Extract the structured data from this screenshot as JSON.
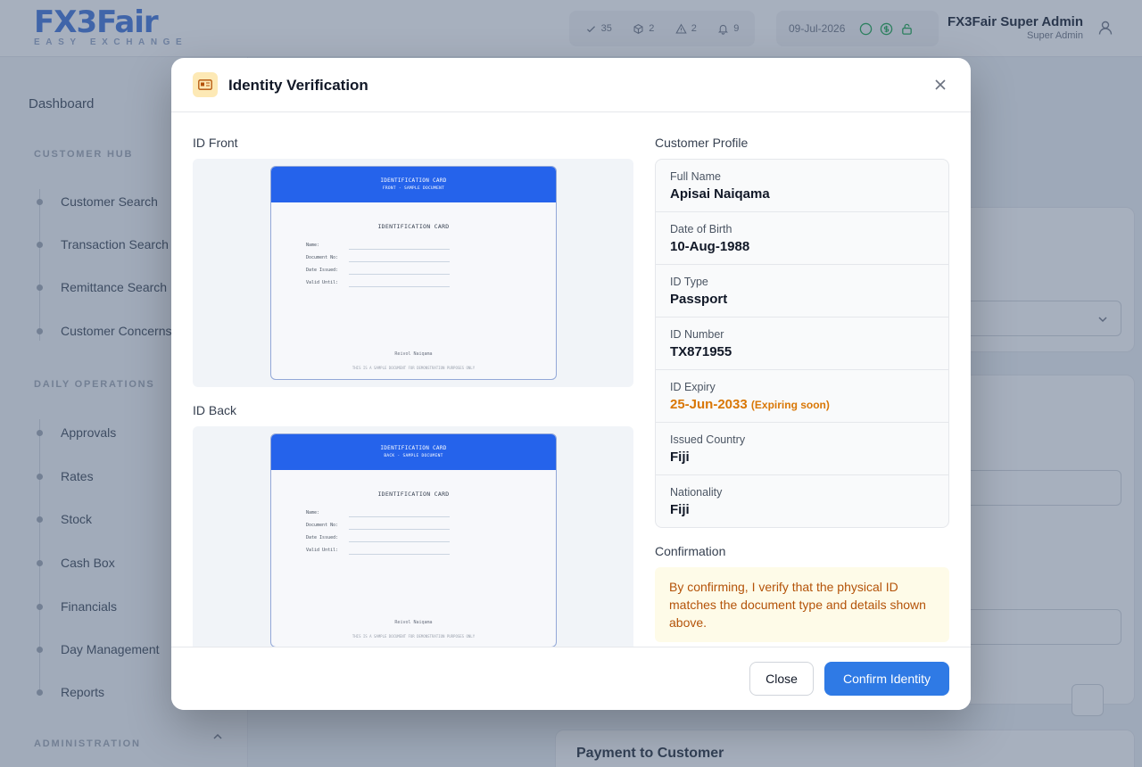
{
  "app": {
    "logo_main": "FX3Fair",
    "logo_sub": "EASY EXCHANGE"
  },
  "topbar": {
    "stats": [
      {
        "icon": "check-icon",
        "value": "35"
      },
      {
        "icon": "box-icon",
        "value": "2"
      },
      {
        "icon": "alert-triangle-icon",
        "value": "2"
      },
      {
        "icon": "bell-icon",
        "value": "9"
      }
    ],
    "date": "09-Jul-2026",
    "user_name": "FX3Fair Super Admin",
    "user_role": "Super Admin"
  },
  "sidebar": {
    "dashboard": "Dashboard",
    "customer_hub": {
      "heading": "CUSTOMER HUB",
      "items": [
        "Customer Search",
        "Transaction Search",
        "Remittance Search",
        "Customer Concerns"
      ]
    },
    "daily_operations": {
      "heading": "DAILY OPERATIONS",
      "items": [
        "Approvals",
        "Rates",
        "Stock",
        "Cash Box",
        "Financials",
        "Day Management",
        "Reports"
      ]
    },
    "administration": {
      "heading": "ADMINISTRATION"
    }
  },
  "background": {
    "payment_title": "Payment to Customer"
  },
  "modal": {
    "title": "Identity Verification",
    "id_front": {
      "label": "ID Front",
      "band_title": "IDENTIFICATION CARD",
      "band_subtitle": "FRONT - SAMPLE DOCUMENT",
      "heading": "IDENTIFICATION CARD",
      "fields": [
        "Name:",
        "Document No:",
        "Date Issued:",
        "Valid Until:"
      ],
      "signature": "Reivol Naiqama",
      "footer": "THIS IS A SAMPLE DOCUMENT FOR DEMONSTRATION PURPOSES ONLY"
    },
    "id_back": {
      "label": "ID Back",
      "band_title": "IDENTIFICATION CARD",
      "band_subtitle": "BACK - SAMPLE DOCUMENT",
      "heading": "IDENTIFICATION CARD",
      "fields": [
        "Name:",
        "Document No:",
        "Date Issued:",
        "Valid Until:"
      ],
      "signature": "Reivol Naiqama",
      "footer": "THIS IS A SAMPLE DOCUMENT FOR DEMONSTRATION PURPOSES ONLY"
    },
    "profile": {
      "label": "Customer Profile",
      "rows": [
        {
          "label": "Full Name",
          "value": "Apisai Naiqama"
        },
        {
          "label": "Date of Birth",
          "value": "10-Aug-1988"
        },
        {
          "label": "ID Type",
          "value": "Passport"
        },
        {
          "label": "ID Number",
          "value": "TX871955"
        },
        {
          "label": "ID Expiry",
          "value": "25-Jun-2033",
          "note": "(Expiring soon)"
        },
        {
          "label": "Issued Country",
          "value": "Fiji"
        },
        {
          "label": "Nationality",
          "value": "Fiji"
        }
      ]
    },
    "confirmation": {
      "label": "Confirmation",
      "text": "By confirming, I verify that the physical ID matches the document type and details shown above."
    },
    "buttons": {
      "close": "Close",
      "confirm": "Confirm Identity"
    }
  },
  "colors": {
    "primary": "#2f7ae5",
    "warning": "#d97706",
    "card_band": "#2563eb"
  }
}
